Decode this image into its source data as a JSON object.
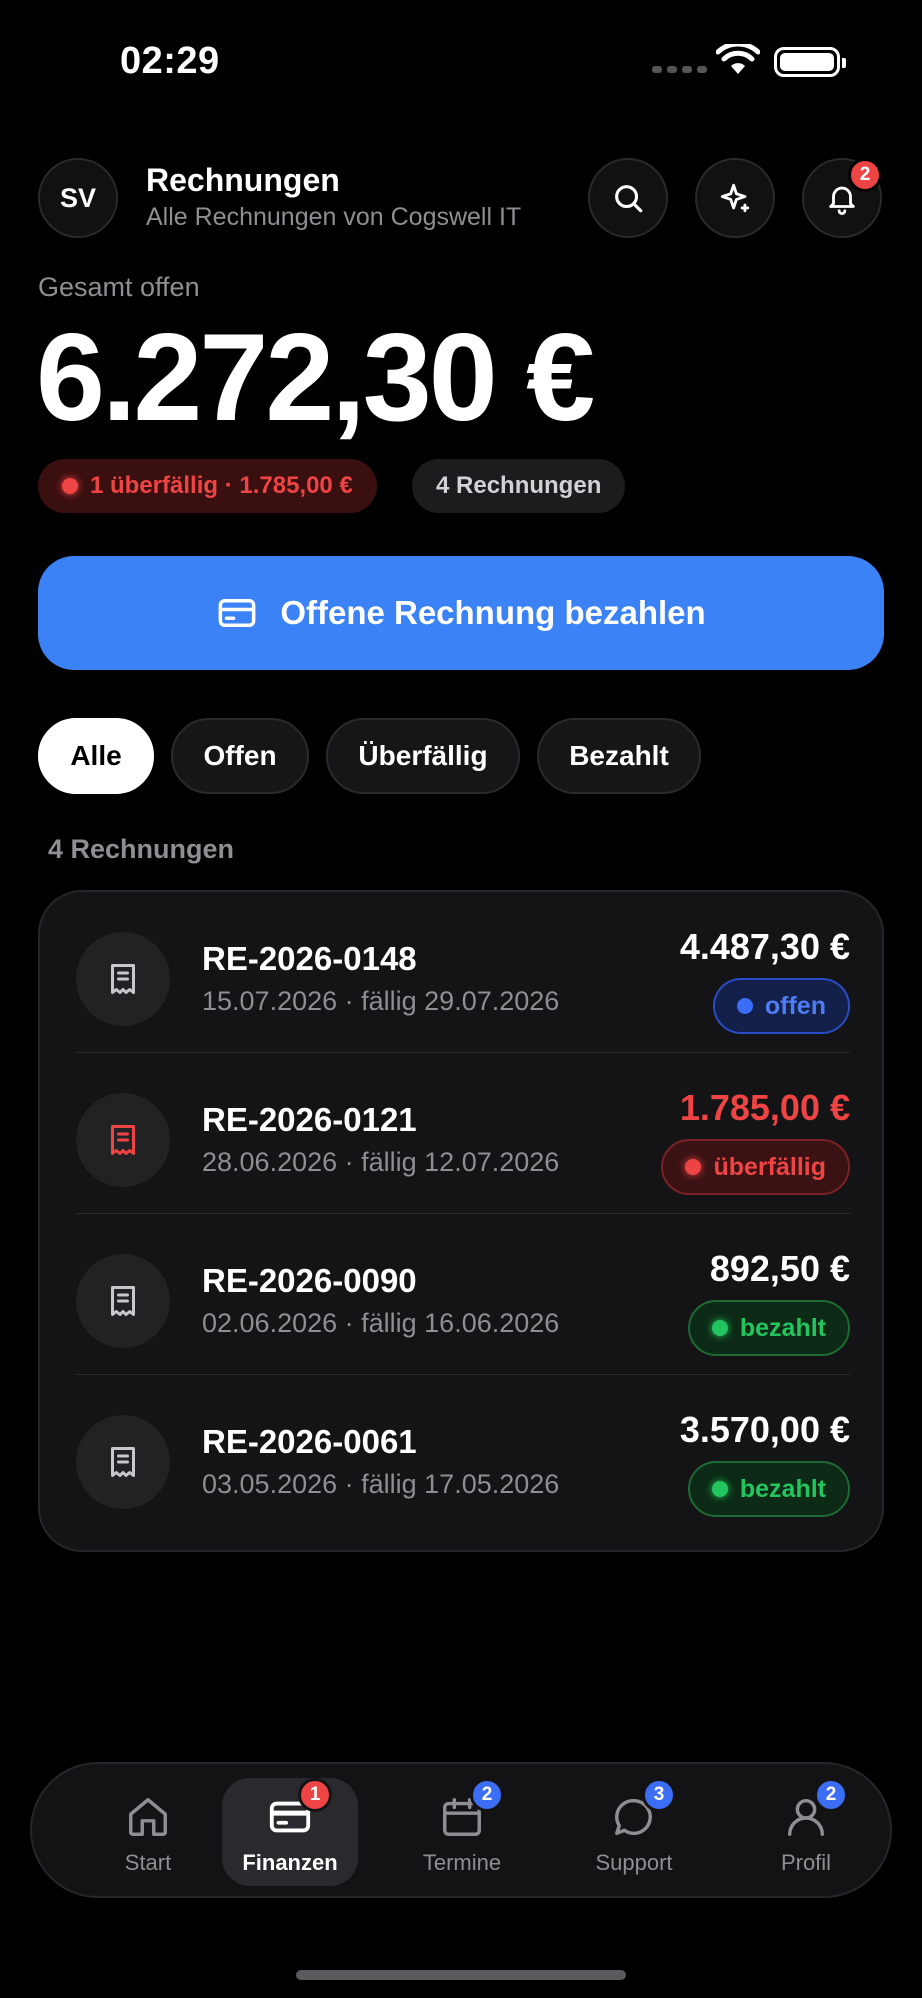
{
  "status_bar": {
    "time": "02:29"
  },
  "header": {
    "avatar_initials": "SV",
    "title": "Rechnungen",
    "subtitle": "Alle Rechnungen von Cogswell IT",
    "notification_count": "2"
  },
  "summary": {
    "label": "Gesamt offen",
    "amount": "6.272,30 €",
    "overdue_pill": "1 überfällig · 1.785,00 €",
    "count_pill": "4 Rechnungen"
  },
  "pay_button": {
    "label": "Offene Rechnung bezahlen"
  },
  "filters": [
    {
      "label": "Alle",
      "active": true
    },
    {
      "label": "Offen",
      "active": false
    },
    {
      "label": "Überfällig",
      "active": false
    },
    {
      "label": "Bezahlt",
      "active": false
    }
  ],
  "list_label": "4 Rechnungen",
  "invoices": [
    {
      "number": "RE-2026-0148",
      "dates": "15.07.2026 · fällig 29.07.2026",
      "amount": "4.487,30 €",
      "status": "offen"
    },
    {
      "number": "RE-2026-0121",
      "dates": "28.06.2026 · fällig 12.07.2026",
      "amount": "1.785,00 €",
      "status": "überfällig"
    },
    {
      "number": "RE-2026-0090",
      "dates": "02.06.2026 · fällig 16.06.2026",
      "amount": "892,50 €",
      "status": "bezahlt"
    },
    {
      "number": "RE-2026-0061",
      "dates": "03.05.2026 · fällig 17.05.2026",
      "amount": "3.570,00 €",
      "status": "bezahlt"
    }
  ],
  "tabbar": [
    {
      "label": "Start",
      "badge": ""
    },
    {
      "label": "Finanzen",
      "badge": "1"
    },
    {
      "label": "Termine",
      "badge": "2"
    },
    {
      "label": "Support",
      "badge": "3"
    },
    {
      "label": "Profil",
      "badge": "2"
    }
  ],
  "colors": {
    "accent": "#3b82f6",
    "overdue": "#ef4444",
    "paid": "#22c55e",
    "background": "#000000"
  }
}
